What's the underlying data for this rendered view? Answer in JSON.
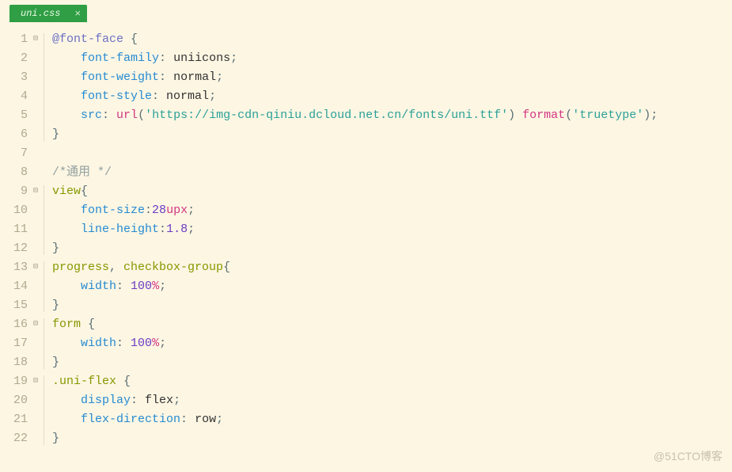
{
  "tab": {
    "filename": "uni.css",
    "close": "×"
  },
  "watermark": "@51CTO博客",
  "foldMarker": "⊟",
  "lines": [
    {
      "n": 1,
      "fold": true,
      "tokens": [
        [
          "@font-face",
          "at"
        ],
        [
          " {",
          "punc"
        ]
      ]
    },
    {
      "n": 2,
      "fold": false,
      "indent": 1,
      "tokens": [
        [
          "font-family",
          "prop"
        ],
        [
          ": ",
          "punc"
        ],
        [
          "uniicons",
          "val"
        ],
        [
          ";",
          "punc"
        ]
      ]
    },
    {
      "n": 3,
      "fold": false,
      "indent": 1,
      "tokens": [
        [
          "font-weight",
          "prop"
        ],
        [
          ": ",
          "punc"
        ],
        [
          "normal",
          "val"
        ],
        [
          ";",
          "punc"
        ]
      ]
    },
    {
      "n": 4,
      "fold": false,
      "indent": 1,
      "tokens": [
        [
          "font-style",
          "prop"
        ],
        [
          ": ",
          "punc"
        ],
        [
          "normal",
          "val"
        ],
        [
          ";",
          "punc"
        ]
      ]
    },
    {
      "n": 5,
      "fold": false,
      "indent": 1,
      "tokens": [
        [
          "src",
          "prop"
        ],
        [
          ": ",
          "punc"
        ],
        [
          "url",
          "fn"
        ],
        [
          "(",
          "punc"
        ],
        [
          "'https://img-cdn-qiniu.dcloud.net.cn/fonts/uni.ttf'",
          "str"
        ],
        [
          ") ",
          "punc"
        ],
        [
          "format",
          "fn"
        ],
        [
          "(",
          "punc"
        ],
        [
          "'truetype'",
          "str"
        ],
        [
          ");",
          "punc"
        ]
      ]
    },
    {
      "n": 6,
      "fold": false,
      "tokens": [
        [
          "}",
          "punc"
        ]
      ]
    },
    {
      "n": 7,
      "fold": false,
      "tokens": []
    },
    {
      "n": 8,
      "fold": false,
      "tokens": [
        [
          "/*通用 */",
          "cmt"
        ]
      ]
    },
    {
      "n": 9,
      "fold": true,
      "tokens": [
        [
          "view",
          "sel"
        ],
        [
          "{",
          "punc"
        ]
      ]
    },
    {
      "n": 10,
      "fold": false,
      "indent": 1,
      "tokens": [
        [
          "font-size",
          "prop"
        ],
        [
          ":",
          "punc"
        ],
        [
          "28",
          "num"
        ],
        [
          "upx",
          "unit"
        ],
        [
          ";",
          "punc"
        ]
      ]
    },
    {
      "n": 11,
      "fold": false,
      "indent": 1,
      "tokens": [
        [
          "line-height",
          "prop"
        ],
        [
          ":",
          "punc"
        ],
        [
          "1.8",
          "num"
        ],
        [
          ";",
          "punc"
        ]
      ]
    },
    {
      "n": 12,
      "fold": false,
      "tokens": [
        [
          "}",
          "punc"
        ]
      ]
    },
    {
      "n": 13,
      "fold": true,
      "tokens": [
        [
          "progress",
          "sel"
        ],
        [
          ", ",
          "punc"
        ],
        [
          "checkbox-group",
          "sel"
        ],
        [
          "{",
          "punc"
        ]
      ]
    },
    {
      "n": 14,
      "fold": false,
      "indent": 1,
      "tokens": [
        [
          "width",
          "prop"
        ],
        [
          ": ",
          "punc"
        ],
        [
          "100",
          "num"
        ],
        [
          "%",
          "unit"
        ],
        [
          ";",
          "punc"
        ]
      ]
    },
    {
      "n": 15,
      "fold": false,
      "tokens": [
        [
          "}",
          "punc"
        ]
      ]
    },
    {
      "n": 16,
      "fold": true,
      "tokens": [
        [
          "form",
          "sel"
        ],
        [
          " {",
          "punc"
        ]
      ]
    },
    {
      "n": 17,
      "fold": false,
      "indent": 1,
      "tokens": [
        [
          "width",
          "prop"
        ],
        [
          ": ",
          "punc"
        ],
        [
          "100",
          "num"
        ],
        [
          "%",
          "unit"
        ],
        [
          ";",
          "punc"
        ]
      ]
    },
    {
      "n": 18,
      "fold": false,
      "tokens": [
        [
          "}",
          "punc"
        ]
      ]
    },
    {
      "n": 19,
      "fold": true,
      "tokens": [
        [
          ".uni-flex",
          "sel"
        ],
        [
          " {",
          "punc"
        ]
      ]
    },
    {
      "n": 20,
      "fold": false,
      "indent": 1,
      "tokens": [
        [
          "display",
          "prop"
        ],
        [
          ": ",
          "punc"
        ],
        [
          "flex",
          "val"
        ],
        [
          ";",
          "punc"
        ]
      ]
    },
    {
      "n": 21,
      "fold": false,
      "indent": 1,
      "tokens": [
        [
          "flex-direction",
          "prop"
        ],
        [
          ": ",
          "punc"
        ],
        [
          "row",
          "val"
        ],
        [
          ";",
          "punc"
        ]
      ]
    },
    {
      "n": 22,
      "fold": false,
      "tokens": [
        [
          "}",
          "punc"
        ]
      ]
    }
  ],
  "guides": [
    {
      "startLine": 1,
      "endLine": 6
    },
    {
      "startLine": 9,
      "endLine": 12
    },
    {
      "startLine": 13,
      "endLine": 15
    },
    {
      "startLine": 16,
      "endLine": 18
    },
    {
      "startLine": 19,
      "endLine": 22
    }
  ]
}
